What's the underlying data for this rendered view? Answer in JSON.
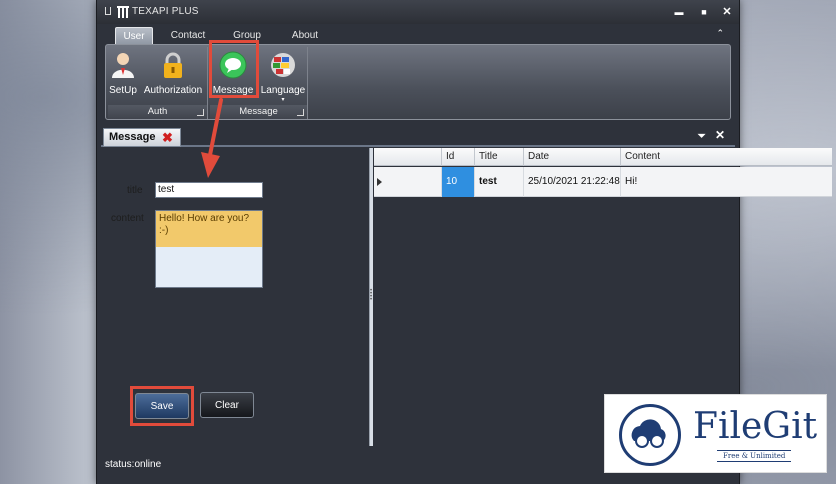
{
  "window": {
    "title": "TEXAPI PLUS",
    "controls": {
      "minimize": "▬",
      "maximize": "■",
      "close": "✕"
    }
  },
  "ribbon": {
    "tabs": [
      {
        "label": "User",
        "active": true
      },
      {
        "label": "Contact",
        "active": false
      },
      {
        "label": "Group",
        "active": false
      },
      {
        "label": "About",
        "active": false
      }
    ],
    "collapse": "⌃",
    "groups": [
      {
        "label": "Auth",
        "buttons": [
          {
            "label": "SetUp",
            "icon": "user-icon"
          },
          {
            "label": "Authorization",
            "icon": "lock-icon"
          }
        ]
      },
      {
        "label": "Message",
        "buttons": [
          {
            "label": "Message",
            "icon": "message-bubble-icon"
          },
          {
            "label": "Language",
            "icon": "flags-globe-icon"
          }
        ]
      }
    ]
  },
  "panel": {
    "tab_label": "Message",
    "tab_close": "✖",
    "pin": "⏷",
    "close": "✕"
  },
  "form": {
    "title_label": "title",
    "title_value": "test",
    "content_label": "content",
    "content_value": "Hello! How are you? :-)",
    "save_label": "Save",
    "clear_label": "Clear"
  },
  "grid": {
    "columns": [
      "Id",
      "Title",
      "Date",
      "Content"
    ],
    "rows": [
      {
        "id": "10",
        "title": "test",
        "date": "25/10/2021 21:22:48",
        "content": "Hi!"
      }
    ]
  },
  "status": {
    "text": "status:online"
  },
  "watermark": {
    "name": "FileGit",
    "tagline": "Free & Unlimited"
  },
  "colors": {
    "accent": "#2f8fe0",
    "highlight": "#e14b3b",
    "brand": "#1f3d74"
  }
}
